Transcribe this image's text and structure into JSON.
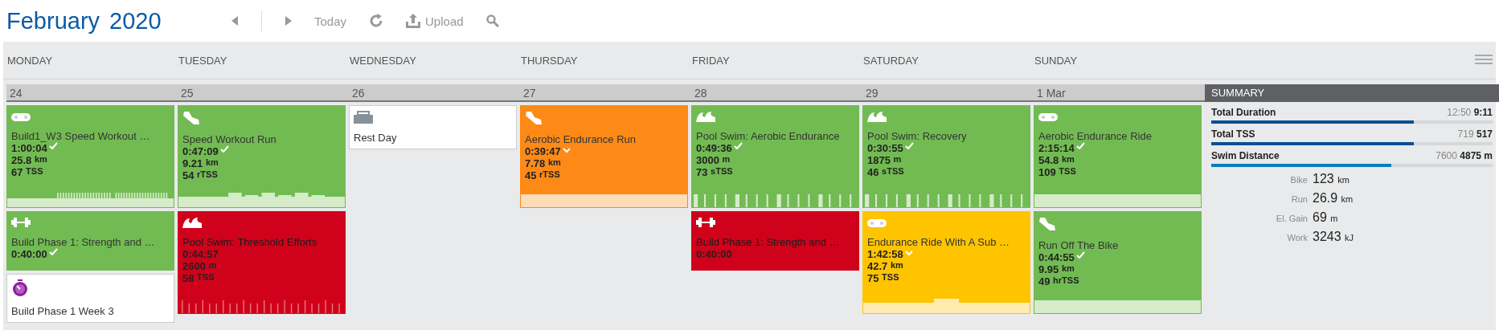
{
  "header": {
    "month": "February",
    "year": "2020",
    "toolbar": [
      {
        "kind": "prev"
      },
      {
        "kind": "next"
      },
      {
        "kind": "text",
        "label": "Today"
      },
      {
        "kind": "refresh"
      },
      {
        "kind": "upload",
        "label": "Upload"
      },
      {
        "kind": "search"
      }
    ]
  },
  "weekdays": [
    "MONDAY",
    "TUESDAY",
    "WEDNESDAY",
    "THURSDAY",
    "FRIDAY",
    "SATURDAY",
    "SUNDAY"
  ],
  "days": [
    {
      "date": "24",
      "cards": [
        {
          "kind": "bike",
          "color": "#72bb53",
          "title": "Build1_W3 Speed Workout …",
          "duration": "1:00:04",
          "marker": {
            "kind": "check"
          },
          "distance": {
            "value": "25.8",
            "unit": "km"
          },
          "tss": {
            "value": "67",
            "unit": "TSS"
          },
          "profile": {
            "kind": "intervals"
          }
        },
        {
          "kind": "strength",
          "color": "#72bb53",
          "title": "Build Phase 1: Strength and …",
          "duration": "0:40:00",
          "marker": {
            "kind": "check"
          }
        },
        {
          "kind": "note",
          "title": "Build Phase 1 Week 3"
        }
      ]
    },
    {
      "date": "25",
      "cards": [
        {
          "kind": "run",
          "color": "#72bb53",
          "title": "Speed Workout Run",
          "duration": "0:47:09",
          "marker": {
            "kind": "check"
          },
          "distance": {
            "value": "9.21",
            "unit": "km"
          },
          "tss": {
            "value": "54",
            "unit": "rTSS"
          },
          "profile": {
            "kind": "steps"
          }
        },
        {
          "kind": "swim",
          "color": "#d0021b",
          "title": "Pool Swim: Threshold Efforts",
          "duration": "0:44:57",
          "distance": {
            "value": "2600",
            "unit": "m"
          },
          "tss": {
            "value": "58",
            "unit": "TSS"
          },
          "profile": {
            "kind": "ticks"
          }
        }
      ]
    },
    {
      "date": "26",
      "cards": [
        {
          "kind": "rest",
          "title": "Rest Day"
        }
      ]
    },
    {
      "date": "27",
      "cards": [
        {
          "kind": "run",
          "color": "#fd8a16",
          "title": "Aerobic Endurance Run",
          "duration": "0:39:47",
          "marker": {
            "kind": "chevron"
          },
          "distance": {
            "value": "7.78",
            "unit": "km"
          },
          "tss": {
            "value": "45",
            "unit": "rTSS"
          },
          "profile": {
            "kind": "flat"
          }
        }
      ]
    },
    {
      "date": "28",
      "cards": [
        {
          "kind": "swim",
          "color": "#72bb53",
          "title": "Pool Swim: Aerobic Endurance",
          "duration": "0:49:36",
          "marker": {
            "kind": "check"
          },
          "distance": {
            "value": "3000",
            "unit": "m"
          },
          "tss": {
            "value": "73",
            "unit": "sTSS"
          },
          "profile": {
            "kind": "bars"
          }
        },
        {
          "kind": "strength",
          "color": "#d0021b",
          "title": "Build Phase 1: Strength and …",
          "duration": "0:40:00"
        }
      ]
    },
    {
      "date": "29",
      "cards": [
        {
          "kind": "swim",
          "color": "#72bb53",
          "title": "Pool Swim: Recovery",
          "duration": "0:30:55",
          "marker": {
            "kind": "check"
          },
          "distance": {
            "value": "1875",
            "unit": "m"
          },
          "tss": {
            "value": "46",
            "unit": "sTSS"
          },
          "profile": {
            "kind": "bars"
          }
        },
        {
          "kind": "bike",
          "color": "#fec400",
          "title": "Endurance Ride With A Sub …",
          "duration": "1:42:58",
          "marker": {
            "kind": "chevron"
          },
          "distance": {
            "value": "42.7",
            "unit": "km"
          },
          "tss": {
            "value": "75",
            "unit": "TSS"
          },
          "profile": {
            "kind": "block"
          }
        }
      ]
    },
    {
      "date": "1 Mar",
      "cards": [
        {
          "kind": "bike",
          "color": "#72bb53",
          "title": "Aerobic Endurance Ride",
          "duration": "2:15:14",
          "marker": {
            "kind": "check"
          },
          "distance": {
            "value": "54.8",
            "unit": "km"
          },
          "tss": {
            "value": "109",
            "unit": "TSS"
          },
          "profile": {
            "kind": "flat"
          }
        },
        {
          "kind": "run",
          "color": "#72bb53",
          "title": "Run Off The Bike",
          "duration": "0:44:55",
          "marker": {
            "kind": "check"
          },
          "distance": {
            "value": "9.95",
            "unit": "km"
          },
          "tss": {
            "value": "49",
            "unit": "hrTSS"
          },
          "profile": {
            "kind": "flat"
          }
        }
      ]
    }
  ],
  "summary": {
    "title": "SUMMARY",
    "totals": [
      {
        "label": "Total Duration",
        "planned": "12:50",
        "actual": "9:11",
        "level": 0.72,
        "color": "#0a4f92"
      },
      {
        "label": "Total TSS",
        "planned": "719",
        "actual": "517",
        "level": 0.72,
        "color": "#0a4f92"
      },
      {
        "label": "Swim Distance",
        "planned": "7600",
        "actual": "4875 m",
        "level": 0.64,
        "color": "#0a7fb8"
      }
    ],
    "stats": [
      {
        "label": "Bike",
        "value": "123",
        "unit": "km"
      },
      {
        "label": "Run",
        "value": "26.9",
        "unit": "km"
      },
      {
        "label": "El. Gain",
        "value": "69",
        "unit": "m"
      },
      {
        "label": "Work",
        "value": "3243",
        "unit": "kJ"
      }
    ]
  }
}
